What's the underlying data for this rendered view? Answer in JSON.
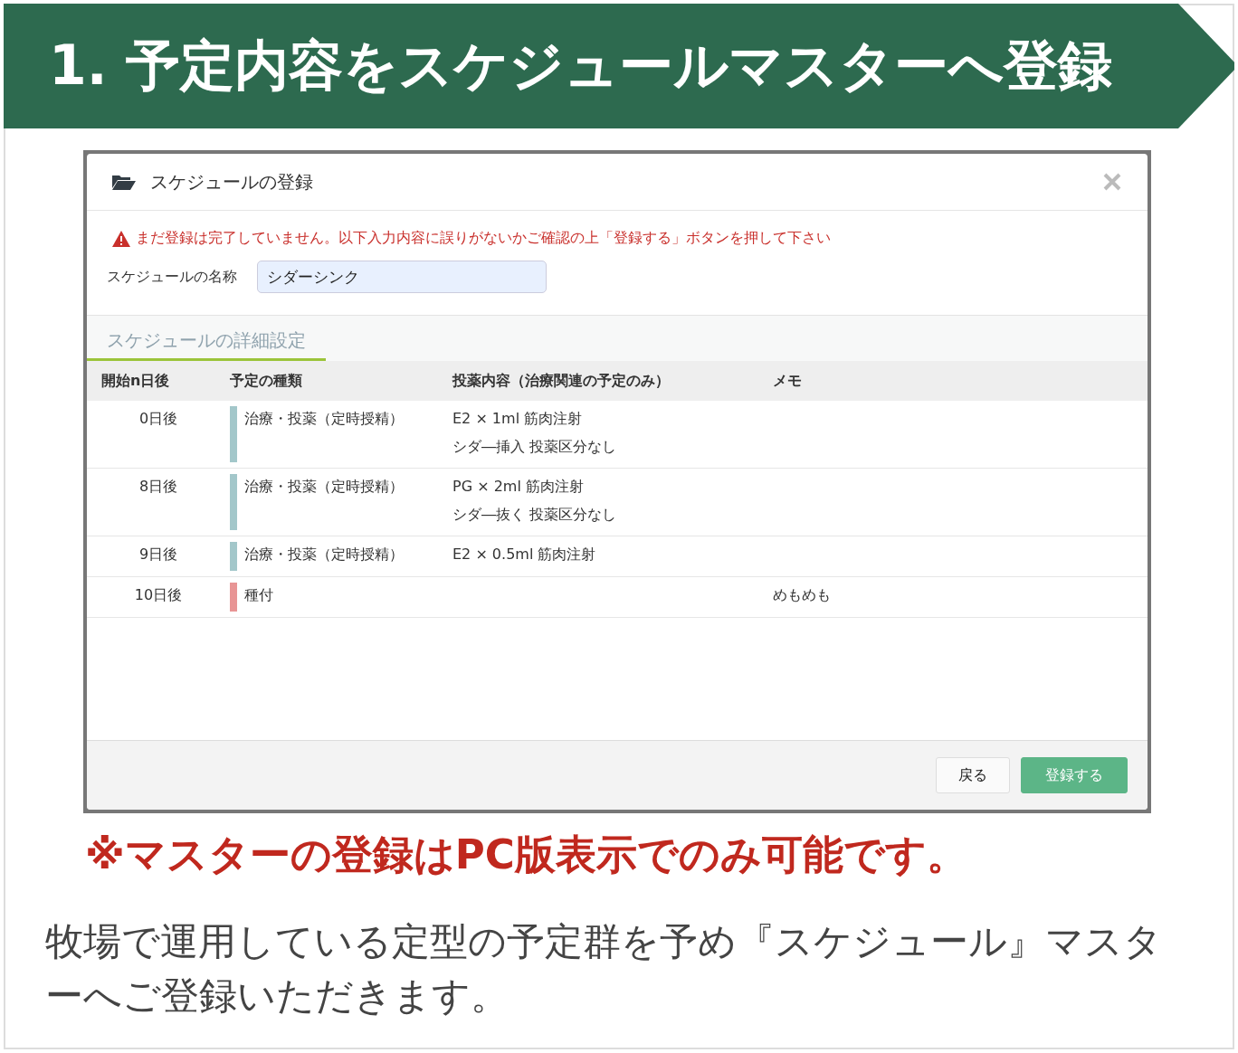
{
  "banner": {
    "title": "1. 予定内容をスケジュールマスターへ登録"
  },
  "dialog": {
    "title": "スケジュールの登録",
    "warning": "まだ登録は完了していません。以下入力内容に誤りがないかご確認の上「登録する」ボタンを押して下さい",
    "name_label": "スケジュールの名称",
    "name_value": "シダーシンク",
    "tabs": [
      {
        "label": "スケジュールの詳細設定",
        "selected": true
      }
    ],
    "table": {
      "columns": [
        "開始n日後",
        "予定の種類",
        "投薬内容（治療関連の予定のみ）",
        "メモ"
      ],
      "rows": [
        {
          "day": "0日後",
          "type": "治療・投薬（定時授精）",
          "color": "#a3c7ca",
          "details": [
            "E2 × 1ml 筋肉注射",
            "シダ―挿入  投薬区分なし"
          ],
          "memo": ""
        },
        {
          "day": "8日後",
          "type": "治療・投薬（定時授精）",
          "color": "#a3c7ca",
          "details": [
            "PG × 2ml 筋肉注射",
            "シダ―抜く  投薬区分なし"
          ],
          "memo": ""
        },
        {
          "day": "9日後",
          "type": "治療・投薬（定時授精）",
          "color": "#a3c7ca",
          "details": [
            "E2 × 0.5ml 筋肉注射"
          ],
          "memo": ""
        },
        {
          "day": "10日後",
          "type": "種付",
          "color": "#e89595",
          "details": [],
          "memo": "めもめも"
        }
      ]
    },
    "buttons": [
      {
        "label": "戻る",
        "kind": "default"
      },
      {
        "label": "登録する",
        "kind": "primary"
      }
    ]
  },
  "note": "※マスターの登録はPC版表示でのみ可能です。",
  "description": "牧場で運用している定型の予定群を予め『スケジュール』マスターへご登録いただきます。"
}
